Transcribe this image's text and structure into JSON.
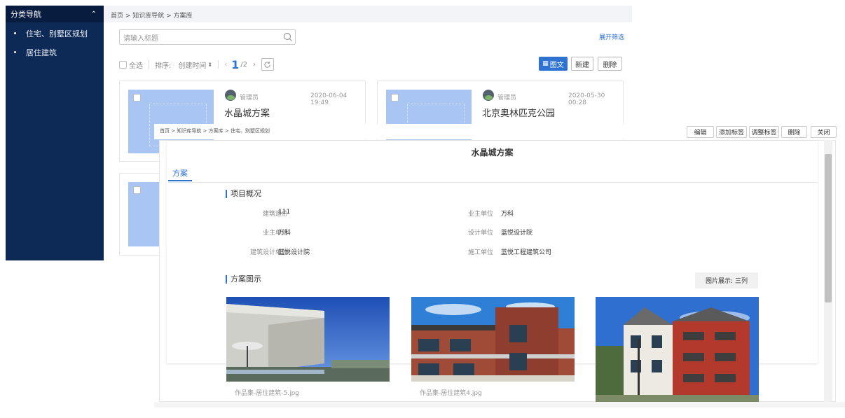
{
  "sidebar": {
    "title": "分类导航",
    "items": [
      {
        "label": "住宅、别墅区规划"
      },
      {
        "label": "居住建筑"
      }
    ]
  },
  "background": {
    "breadcrumb": "首页 > 知识库导航 > 方案库",
    "search_placeholder": "请输入标题",
    "expand_filter": "展开筛选",
    "select_all": "全选",
    "sort_label": "排序:",
    "sort_field": "创建时间",
    "page_current": "1",
    "page_total": "/2",
    "btn_tuwen": "图文",
    "btn_new": "新建",
    "btn_delete": "删除",
    "cards": [
      {
        "user": "管理员",
        "date": "2020-06-04 19:49",
        "title": "水晶城方案"
      },
      {
        "user": "管理员",
        "date": "2020-05-30 00:28",
        "title": "北京奥林匹克公园"
      }
    ]
  },
  "overlay": {
    "breadcrumb": "首页 > 知识库导航 > 方案库 > 住宅、别墅区规划",
    "actions": [
      "编辑",
      "添加标签",
      "调整标签",
      "删除",
      "关闭"
    ],
    "title": "水晶城方案",
    "tab": "方案",
    "overview_title": "项目概况",
    "fields": [
      {
        "label": "建筑造价",
        "value": "111"
      },
      {
        "label": "业主单位",
        "value": "万科"
      },
      {
        "label": "业主单位",
        "value": "万科"
      },
      {
        "label": "设计单位",
        "value": "蓝悦设计院"
      },
      {
        "label": "建筑设计单位",
        "value": "蓝悦设计院"
      },
      {
        "label": "施工单位",
        "value": "蓝悦工程建筑公司"
      }
    ],
    "images_title": "方案图示",
    "layout_btn": "图片展示: 三列",
    "images": [
      {
        "caption": "作品集-居住建筑-5.jpg"
      },
      {
        "caption": "作品集-居住建筑4.jpg"
      },
      {
        "caption": ""
      }
    ]
  }
}
